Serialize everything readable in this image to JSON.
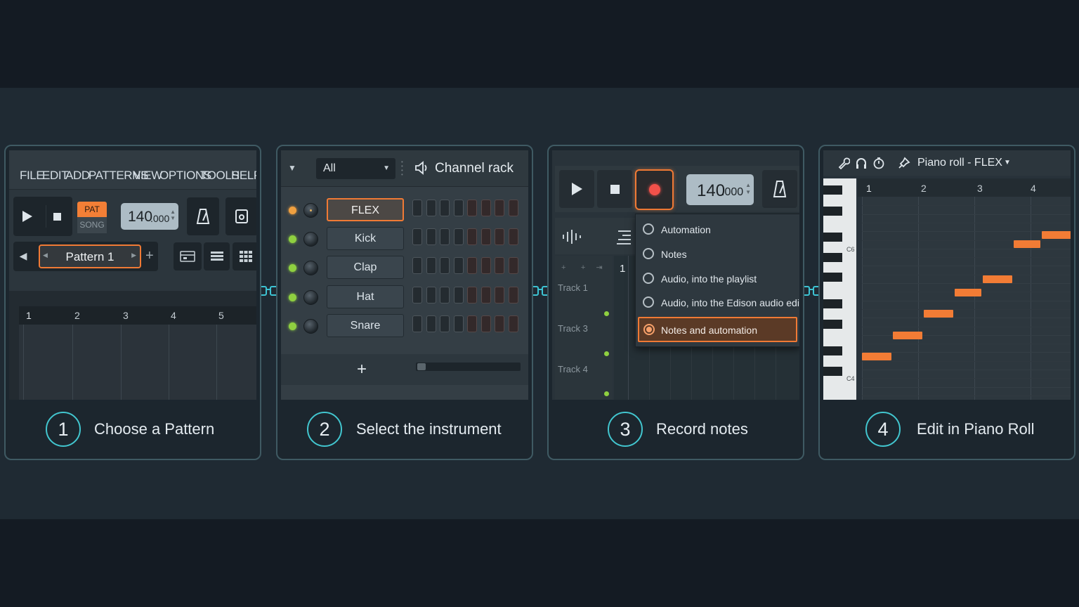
{
  "steps": [
    {
      "number": "1",
      "label": "Choose a Pattern"
    },
    {
      "number": "2",
      "label": "Select the instrument"
    },
    {
      "number": "3",
      "label": "Record notes"
    },
    {
      "number": "4",
      "label": "Edit in Piano Roll"
    }
  ],
  "panel1": {
    "menu": [
      "FILE",
      "EDIT",
      "ADD",
      "PATTERNS",
      "VIEW",
      "OPTIONS",
      "TOOLS",
      "HELP"
    ],
    "pat_label": "PAT",
    "song_label": "SONG",
    "tempo_main": "140",
    "tempo_decimal": ".000",
    "pattern_name": "Pattern 1",
    "add_symbol": "+",
    "ruler": [
      "1",
      "2",
      "3",
      "4",
      "5"
    ]
  },
  "panel2": {
    "filter_value": "All",
    "title": "Channel rack",
    "channels": [
      "FLEX",
      "Kick",
      "Clap",
      "Hat",
      "Snare"
    ],
    "selected_channel": "FLEX",
    "add_symbol": "+"
  },
  "panel3": {
    "tempo_main": "140",
    "tempo_decimal": ".000",
    "record_options": [
      "Automation",
      "Notes",
      "Audio, into the playlist",
      "Audio, into the Edison audio editor",
      "Notes and automation"
    ],
    "selected_option": "Notes and automation",
    "tracks": [
      "Track 1",
      "Track 3",
      "Track 4"
    ],
    "ruler_start": "1"
  },
  "panel4": {
    "title": "Piano roll - FLEX",
    "ruler": [
      "1",
      "2",
      "3",
      "4"
    ],
    "key_labels": [
      "C6",
      "C4"
    ],
    "notes": [
      {
        "start": 0.0,
        "len": 0.55,
        "pitch": 0
      },
      {
        "start": 0.55,
        "len": 0.55,
        "pitch": 1
      },
      {
        "start": 1.1,
        "len": 0.55,
        "pitch": 2
      },
      {
        "start": 1.65,
        "len": 0.5,
        "pitch": 3
      },
      {
        "start": 2.15,
        "len": 0.55,
        "pitch": 4
      },
      {
        "start": 2.7,
        "len": 0.5,
        "pitch": 5
      },
      {
        "start": 3.2,
        "len": 0.6,
        "pitch": 6
      }
    ]
  },
  "colors": {
    "accent": "#f27c35",
    "teal": "#3dc4d4",
    "led_green": "#8fd040",
    "led_orange": "#f0a040",
    "record_red": "#f2514a"
  }
}
